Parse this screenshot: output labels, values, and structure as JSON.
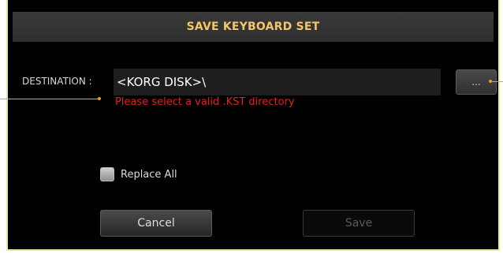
{
  "dialog": {
    "title": "SAVE KEYBOARD SET"
  },
  "destination": {
    "label": "DESTINATION :",
    "value": "<KORG DISK>\\",
    "error": "Please select a valid .KST directory",
    "browse_label": "..."
  },
  "options": {
    "replace_all_label": "Replace All",
    "replace_all_checked": false
  },
  "buttons": {
    "cancel_label": "Cancel",
    "save_label": "Save",
    "save_enabled": false
  },
  "colors": {
    "title_text": "#f4c66a",
    "error_text": "#e0231b",
    "callout": "#f0a020",
    "frame_border": "#e8e8a0"
  }
}
